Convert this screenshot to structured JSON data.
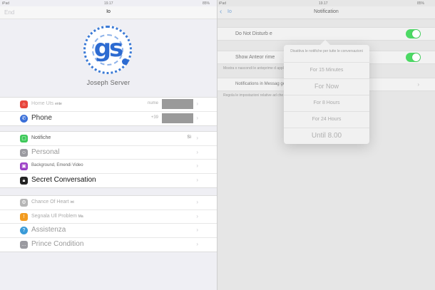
{
  "status": {
    "time": "19.17",
    "battery": "85%",
    "carrier_left": "iPad",
    "time_right": "19.17",
    "battery_right": "85%",
    "carrier_right": "iPad"
  },
  "left": {
    "nav": {
      "edit_label": "End",
      "title": "Io"
    },
    "profile": {
      "logo_text": "gs",
      "name": "Joseph Server"
    },
    "group1": [
      {
        "icon": "home-icon",
        "color": "#e8463d",
        "label": "Home Uts",
        "suffix": "ente",
        "value": "nume",
        "blurred": true
      },
      {
        "icon": "phone-icon",
        "color": "#3a6fd8",
        "label": "Phone",
        "value": "+39",
        "blurred": true
      }
    ],
    "group2": [
      {
        "icon": "notifications-icon",
        "color": "#3ec95a",
        "label": "Notifiche",
        "value": "Sì"
      },
      {
        "icon": "people-icon",
        "color": "#9a9aa0",
        "label": "Personal"
      },
      {
        "icon": "photo-icon",
        "color": "#9b3fc6",
        "label": "Background, Emendi Video"
      },
      {
        "icon": "lock-icon",
        "color": "#222222",
        "label": "Secret Conversation"
      }
    ],
    "group3": [
      {
        "icon": "settings-icon",
        "color": "#b5b5b5",
        "label": "Chance Of Heart",
        "suffix": "int"
      },
      {
        "icon": "bug-icon",
        "color": "#f29b1f",
        "label": "Segnala Ull Problem",
        "suffix": "Ma"
      },
      {
        "icon": "help-icon",
        "color": "#3a9bd8",
        "label": "Assistenza"
      },
      {
        "icon": "more-icon",
        "color": "#9a9aa0",
        "label": "Prince Condition"
      }
    ]
  },
  "right": {
    "nav": {
      "back_label": "Io",
      "title": "Notification"
    },
    "dnd_label": "Do Not Disturb",
    "dnd_suffix": "e",
    "preview_label": "Show Anteor",
    "preview_suffix": "rime",
    "preview_note": "Mostra o nascondi le anteprime d                                         applicazione.",
    "inapp_label": "Notifications in Messag",
    "inapp_suffix": "ge",
    "inapp_note": "Regola le impostazioni relative ad                                         che ricevi quando usi l'applicazione.",
    "popover": {
      "header": "Disattiva le notifiche per tutte le conversazioni",
      "options": [
        "For 15 Minutes",
        "For Now",
        "For 8 Hours",
        "For 24 Hours",
        "Until 8.00"
      ]
    },
    "colors": {
      "toggle_on": "#4cd964",
      "accent": "#7aa6d8"
    }
  }
}
